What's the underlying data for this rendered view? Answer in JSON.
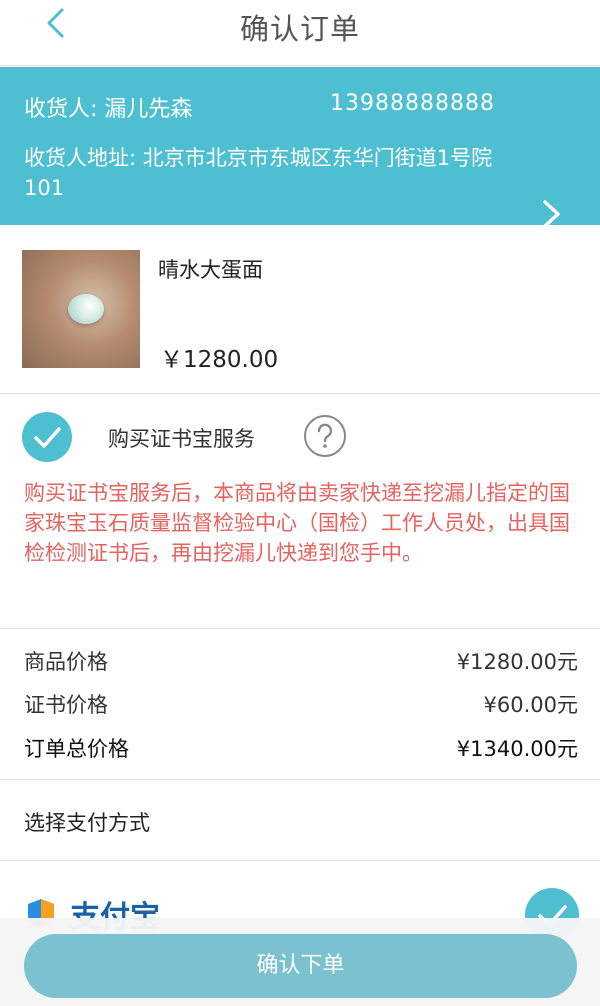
{
  "nav": {
    "title": "确认订单",
    "back_icon": "chevron-left-icon"
  },
  "address": {
    "recipient": "收货人: 漏儿先森",
    "phone": "13988888888",
    "address": "收货人地址: 北京市北京市东城区东华门街道1号院101"
  },
  "product": {
    "name": "晴水大蛋面",
    "price": "￥1280.00"
  },
  "certificate": {
    "label": "购买证书宝服务",
    "checked": true,
    "description": "购买证书宝服务后，本商品将由卖家快递至挖漏儿指定的国家珠宝玉石质量监督检验中心（国检）工作人员处，出具国检检测证书后，再由挖漏儿快递到您手中。"
  },
  "prices": {
    "item_label": "商品价格",
    "item_value": "¥1280.00元",
    "cert_label": "证书价格",
    "cert_value": "¥60.00元",
    "total_label": "订单总价格",
    "total_value": "¥1340.00元"
  },
  "payment": {
    "title": "选择支付方式",
    "method": "支付宝",
    "selected": true
  },
  "footer": {
    "submit": "确认下单"
  },
  "colors": {
    "accent": "#4ebfd1",
    "warning_text": "#e4635f",
    "button": "#7cc1d0"
  }
}
